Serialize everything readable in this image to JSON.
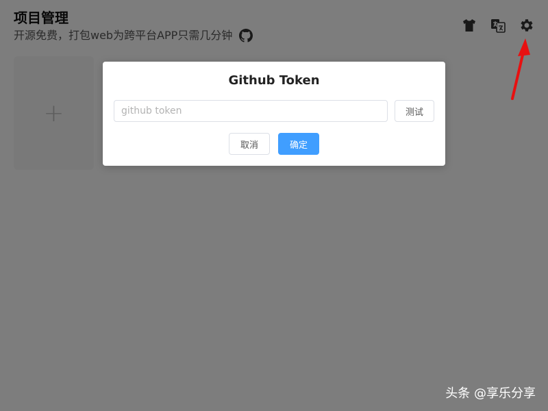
{
  "header": {
    "title": "项目管理",
    "subtitle": "开源免费，打包web为跨平台APP只需几分钟"
  },
  "toolbar": {
    "icons": [
      "tshirt-icon",
      "translate-icon",
      "gear-icon"
    ]
  },
  "add_card": {
    "symbol": "+"
  },
  "dialog": {
    "title": "Github Token",
    "input_placeholder": "github token",
    "input_value": "",
    "test_label": "测试",
    "cancel_label": "取消",
    "confirm_label": "确定"
  },
  "watermark": "头条 @享乐分享",
  "colors": {
    "primary": "#409eff",
    "annotation_arrow": "#e81010",
    "overlay": "rgba(0,0,0,0.5)"
  }
}
